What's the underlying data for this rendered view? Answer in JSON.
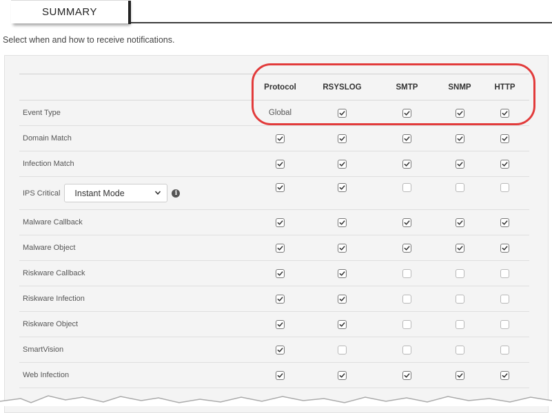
{
  "tab": {
    "label": "SUMMARY"
  },
  "subtitle": "Select when and how to receive notifications.",
  "columns": [
    "Protocol",
    "RSYSLOG",
    "SMTP",
    "SNMP",
    "HTTP"
  ],
  "header_row": {
    "label": "Event Type",
    "protocol_value": "Global",
    "checks": [
      true,
      true,
      true,
      true
    ]
  },
  "rows": [
    {
      "label": "Domain Match",
      "checks": [
        true,
        true,
        true,
        true,
        true
      ]
    },
    {
      "label": "Infection Match",
      "checks": [
        true,
        true,
        true,
        true,
        true
      ]
    },
    {
      "label": "IPS Critical",
      "select": "Instant Mode",
      "checks": [
        true,
        true,
        false,
        false,
        false
      ]
    },
    {
      "label": "Malware Callback",
      "checks": [
        true,
        true,
        true,
        true,
        true
      ]
    },
    {
      "label": "Malware Object",
      "checks": [
        true,
        true,
        true,
        true,
        true
      ]
    },
    {
      "label": "Riskware Callback",
      "checks": [
        true,
        true,
        false,
        false,
        false
      ]
    },
    {
      "label": "Riskware Infection",
      "checks": [
        true,
        true,
        false,
        false,
        false
      ]
    },
    {
      "label": "Riskware Object",
      "checks": [
        true,
        true,
        false,
        false,
        false
      ]
    },
    {
      "label": "SmartVision",
      "checks": [
        true,
        false,
        false,
        false,
        false
      ]
    },
    {
      "label": "Web Infection",
      "checks": [
        true,
        true,
        true,
        true,
        true
      ]
    }
  ],
  "colors": {
    "highlight": "#e23b3b",
    "panel": "#f4f4f4"
  }
}
